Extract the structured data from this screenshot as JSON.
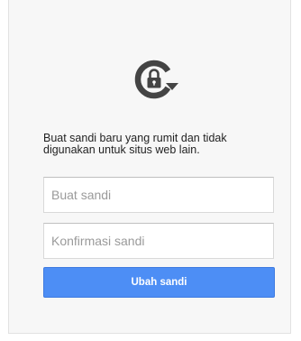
{
  "icon": "lock-refresh-icon",
  "colors": {
    "icon": "#444444",
    "icon_lock": "#ffffff",
    "button_bg": "#4d8ef5",
    "card_bg": "#f7f7f7"
  },
  "instruction": "Buat sandi baru yang rumit dan tidak digunakan untuk situs web lain.",
  "form": {
    "new_password_placeholder": "Buat sandi",
    "confirm_password_placeholder": "Konfirmasi sandi",
    "submit_label": "Ubah sandi"
  }
}
